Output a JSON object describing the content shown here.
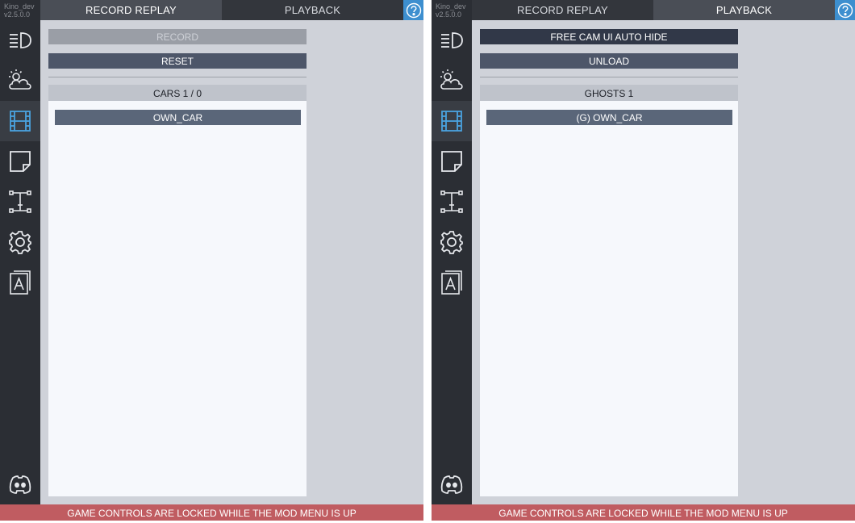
{
  "left": {
    "brand": {
      "name": "Kino_dev",
      "version": "v2.5.0.0"
    },
    "tabs": [
      {
        "label": "RECORD REPLAY",
        "active": true
      },
      {
        "label": "PLAYBACK",
        "active": false
      }
    ],
    "buttons": {
      "record": "RECORD",
      "reset": "RESET"
    },
    "list": {
      "header": "CARS 1 / 0",
      "items": [
        "OWN_CAR"
      ]
    },
    "footer": "GAME CONTROLS ARE LOCKED WHILE THE MOD MENU IS UP"
  },
  "right": {
    "brand": {
      "name": "Kino_dev",
      "version": "v2.5.0.0"
    },
    "tabs": [
      {
        "label": "RECORD REPLAY",
        "active": false
      },
      {
        "label": "PLAYBACK",
        "active": true
      }
    ],
    "buttons": {
      "free_cam": "FREE CAM UI AUTO HIDE",
      "unload": "UNLOAD"
    },
    "list": {
      "header": "GHOSTS 1",
      "items": [
        "(G) OWN_CAR"
      ]
    },
    "footer": "GAME CONTROLS ARE LOCKED WHILE THE MOD MENU IS UP"
  },
  "sidebar_icons": [
    "headlight-icon",
    "weather-icon",
    "film-icon",
    "note-icon",
    "suspension-icon",
    "gear-icon",
    "font-icon",
    "discord-icon"
  ],
  "colors": {
    "accent": "#3d8fcf",
    "footer": "#c05c61",
    "sidebar": "#2b2e34",
    "active_icon": "#4aa3e0"
  }
}
